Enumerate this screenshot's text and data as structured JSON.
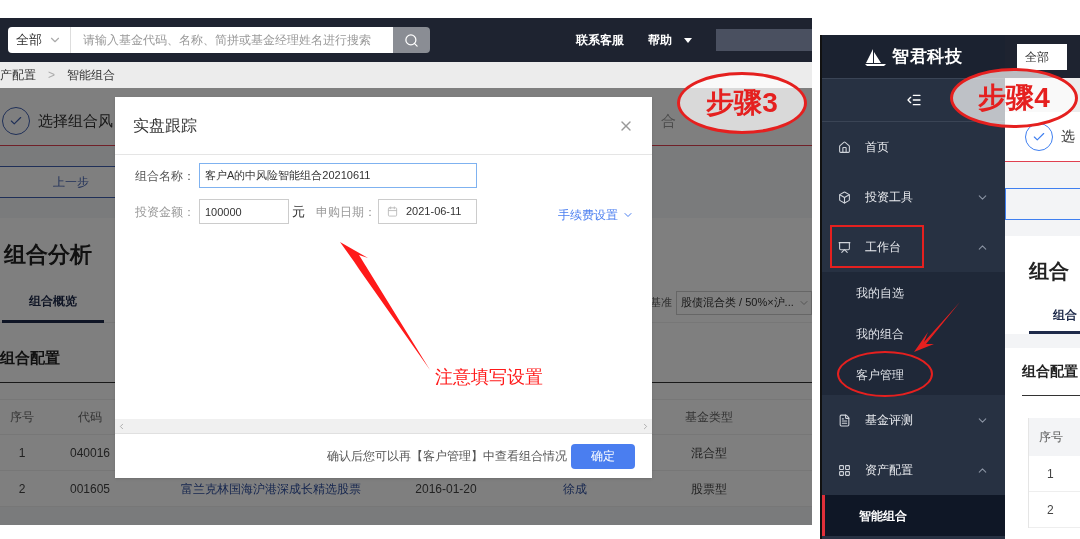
{
  "left_screen": {
    "top_bar": {
      "scope_select": "全部",
      "search": {
        "placeholder": "请输入基金代码、名称、简拼或基金经理姓名进行搜索"
      },
      "links": [
        "联系客服",
        "帮助"
      ]
    },
    "breadcrumb": {
      "items": [
        "产配置",
        "智能组合"
      ],
      "separator": ">"
    },
    "steps": [
      {
        "label": "选择组合风",
        "done": true
      },
      {
        "label": "合",
        "done": false
      }
    ],
    "back_button": "上一步",
    "heading": "组合分析",
    "tabs": [
      {
        "label": "组合概览",
        "selected": true
      }
    ],
    "benchmark": {
      "label": "基准",
      "value": "股债混合类 / 50%×沪..."
    },
    "section_title": "组合配置",
    "table": {
      "columns": [
        "序号",
        "代码",
        null,
        null,
        null,
        "基金类型"
      ],
      "rows": [
        [
          "1",
          "040016",
          null,
          null,
          null,
          "混合型"
        ],
        [
          "2",
          "001605",
          "富兰克林国海沪港深成长精选股票",
          "2016-01-20",
          "徐成",
          "股票型"
        ]
      ]
    },
    "dialog": {
      "title": "实盘跟踪",
      "fields": [
        {
          "label": "组合名称：",
          "value": "客户A的中风险智能组合20210611",
          "focused": true
        },
        {
          "label": "投资金额：",
          "value": "100000",
          "unit": "元",
          "focused": false
        },
        {
          "label": "申购日期：",
          "value": "2021-06-11",
          "focused": false
        }
      ],
      "fee_settings": "手续费设置",
      "footer_note": "确认后您可以再【客户管理】中查看组合情况",
      "confirm_button": "确定"
    }
  },
  "right_screen": {
    "logo": "智君科技",
    "scope_select": "全部",
    "menu": [
      {
        "label": "首页",
        "kind": "link"
      },
      {
        "label": "投资工具",
        "kind": "group",
        "expanded": false
      },
      {
        "label": "工作台",
        "kind": "group",
        "expanded": true,
        "boxed": true,
        "children": [
          {
            "label": "我的自选",
            "selected": false
          },
          {
            "label": "我的组合",
            "selected": false
          },
          {
            "label": "客户管理",
            "selected": false,
            "circled": true
          }
        ]
      },
      {
        "label": "基金评测",
        "kind": "group",
        "expanded": false
      },
      {
        "label": "资产配置",
        "kind": "group",
        "expanded": true,
        "children": [
          {
            "label": "智能组合",
            "selected": true
          }
        ]
      }
    ],
    "step_label": "选",
    "heading": "组合",
    "tabs": [
      {
        "label": "组合",
        "selected": true
      }
    ],
    "section_title": "组合配置",
    "table": {
      "columns": [
        "序号"
      ],
      "rows": [
        [
          "1"
        ],
        [
          "2"
        ]
      ]
    }
  },
  "annotations": [
    {
      "kind": "step",
      "text": "步骤3"
    },
    {
      "kind": "step",
      "text": "步骤4"
    },
    {
      "kind": "note",
      "text": "注意填写设置"
    }
  ]
}
